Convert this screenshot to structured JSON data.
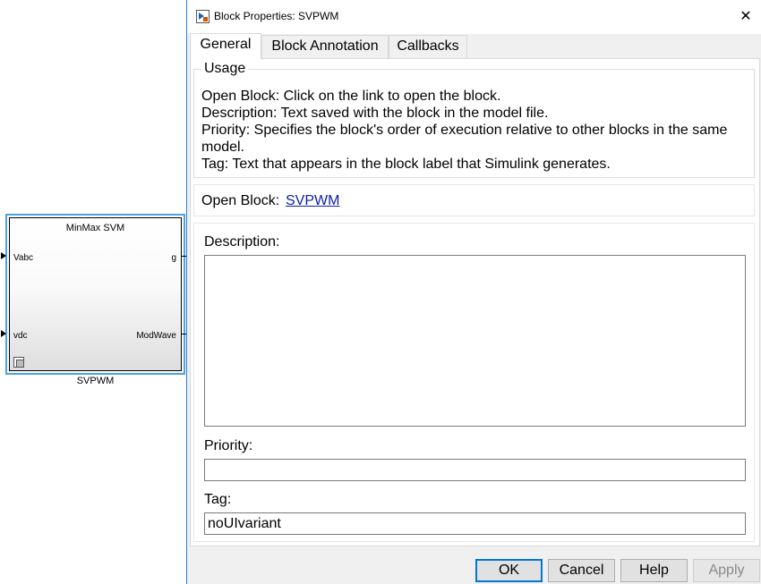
{
  "canvas": {
    "block": {
      "title": "MinMax SVM",
      "name": "SVPWM",
      "inputs": [
        "Vabc",
        "vdc"
      ],
      "outputs": [
        "g",
        "ModWave"
      ],
      "subsystem_icon": "subsystem-icon"
    }
  },
  "dialog": {
    "title": "Block Properties: SVPWM",
    "close_glyph": "✕",
    "tabs": [
      {
        "label": "General",
        "active": true
      },
      {
        "label": "Block Annotation",
        "active": false
      },
      {
        "label": "Callbacks",
        "active": false
      }
    ],
    "usage": {
      "legend": "Usage",
      "lines": [
        "Open Block: Click on the link to open the block.",
        "Description: Text saved with the block in the model file.",
        "Priority: Specifies the block's order of execution relative to other blocks in the same model.",
        "Tag: Text that appears in the block label that Simulink generates."
      ]
    },
    "open_block": {
      "label": "Open Block:",
      "link_text": "SVPWM"
    },
    "fields": {
      "description_label": "Description:",
      "description_value": "",
      "priority_label": "Priority:",
      "priority_value": "",
      "tag_label": "Tag:",
      "tag_value": "noUIvariant"
    },
    "buttons": {
      "ok": "OK",
      "cancel": "Cancel",
      "help": "Help",
      "apply": "Apply"
    }
  },
  "colors": {
    "selection_border": "#4aa3df",
    "link": "#0b1ea8",
    "default_button_border": "#0078d7"
  }
}
